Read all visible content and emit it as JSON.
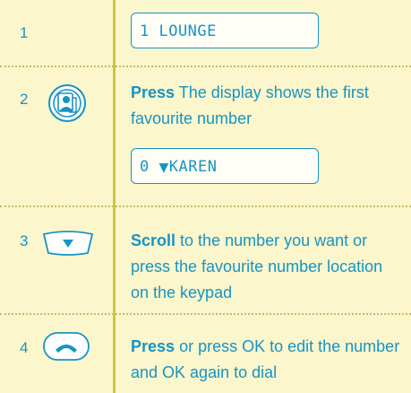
{
  "steps": [
    {
      "number": "1",
      "display": "1 LOUNGE"
    },
    {
      "number": "2",
      "icon": "phonebook-contact-icon",
      "action": "Press",
      "text": "The display shows the first favourite number",
      "display_prefix": "0",
      "display_arrow": "▼",
      "display_name": "KAREN"
    },
    {
      "number": "3",
      "icon": "scroll-down-key-icon",
      "action": "Scroll",
      "text": "to the number you want or press the favourite number location on the keypad"
    },
    {
      "number": "4",
      "icon": "talk-handset-key-icon",
      "action": "Press",
      "text": "or press OK to edit the number and OK again to dial"
    }
  ],
  "colors": {
    "text": "#1794c4",
    "background": "#fbf6cc",
    "divider": "#c9ba6a",
    "rule": "#d1c341"
  }
}
